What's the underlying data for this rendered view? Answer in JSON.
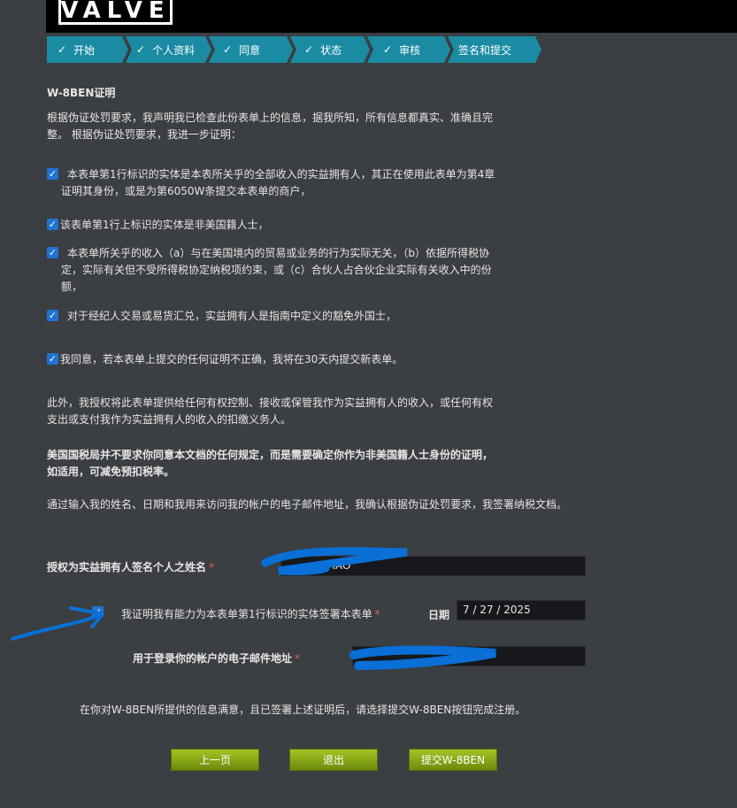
{
  "logo": "VALVE",
  "steps": [
    {
      "label": "开始",
      "done": true
    },
    {
      "label": "个人资料",
      "done": true
    },
    {
      "label": "同意",
      "done": true
    },
    {
      "label": "状态",
      "done": true
    },
    {
      "label": "审核",
      "done": true
    },
    {
      "label": "签名和提交",
      "done": false
    }
  ],
  "check_glyph": "✓",
  "heading": "W-8BEN证明",
  "intro_line1": "根据伪证处罚要求，我声明我已检查此份表单上的信息，据我所知，所有信息都真实、准确且完",
  "intro_line2": "整。 根据伪证处罚要求，我进一步证明：",
  "certs": [
    {
      "lines": [
        "本表单第1行标识的实体是本表所关乎的全部收入的实益拥有人，其正在使用此表单为第4章",
        "证明其身份，或是为第6050W条提交本表单的商户，"
      ]
    },
    {
      "lines": [
        "该表单第1行上标识的实体是非美国籍人士，"
      ]
    },
    {
      "lines": [
        "本表单所关乎的收入（a）与在美国境内的贸易或业务的行为实际无关，（b）依据所得税协",
        "定，实际有关但不受所得税协定纳税项约束，或（c）合伙人占合伙企业实际有关收入中的份",
        "额，"
      ]
    },
    {
      "lines": [
        "对于经纪人交易或易货汇兑，实益拥有人是指南中定义的豁免外国士，"
      ]
    },
    {
      "lines": [
        "我同意，若本表单上提交的任何证明不正确，我将在30天内提交新表单。"
      ]
    }
  ],
  "auth_line1": "此外，我授权将此表单提供给任何有权控制、接收或保管我作为实益拥有人的收入，或任何有权",
  "auth_line2": "支出或支付我作为实益拥有人的收入的扣缴义务人。",
  "irs_line1": "美国国税局并不要求你同意本文档的任何规定，而是需要确定你作为非美国籍人士身份的证明，",
  "irs_line2": "如适用，可减免预扣税率。",
  "sign_notice": "通过输入我的姓名、日期和我用来访问我的帐户的电子邮件地址，我确认根据伪证处罚要求，我签署纳税文档。",
  "form": {
    "name_label": "授权为实益拥有人签名个人之姓名",
    "name_value": "HAO",
    "capacity_label": "我证明我有能力为本表单第1行标识的实体签署本表单",
    "date_label": "日期",
    "date_value": "7 / 27 / 2025",
    "email_label": "用于登录你的帐户的电子邮件地址",
    "required_mark": "*"
  },
  "final_notice": "在你对W-8BEN所提供的信息满意，且已签署上述证明后，请选择提交W-8BEN按钮完成注册。",
  "buttons": {
    "prev": "上一页",
    "exit": "退出",
    "submit": "提交W-8BEN"
  },
  "colors": {
    "background": "#3b3e42",
    "step_bar": "#1a8ba3",
    "checkbox": "#1f73d1",
    "button_green": "#8aaa16",
    "scribble_blue": "#0a6fd6"
  }
}
